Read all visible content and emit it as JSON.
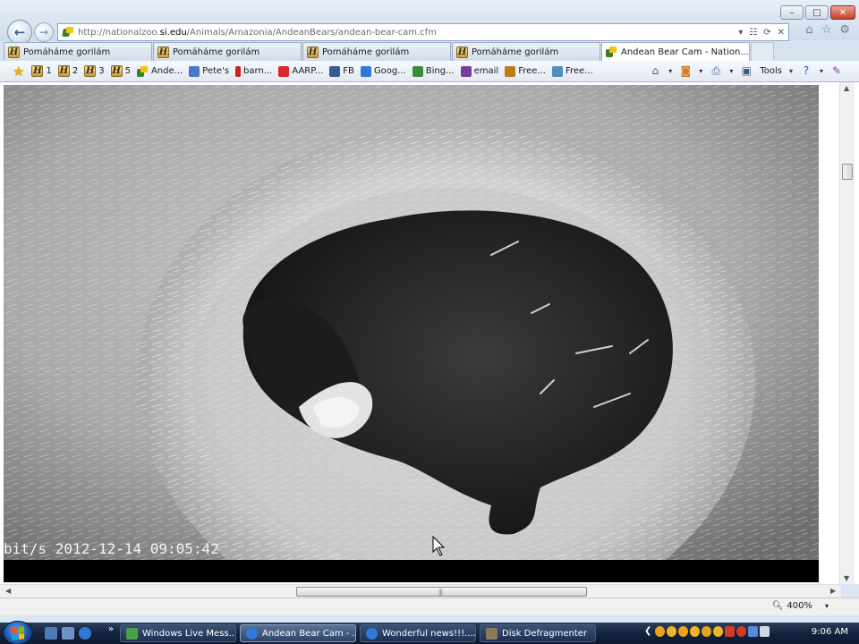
{
  "window": {
    "minimize_glyph": "–",
    "maximize_glyph": "□",
    "close_glyph": "✕"
  },
  "nav": {
    "back_glyph": "←",
    "forward_glyph": "→"
  },
  "address": {
    "url_prefix": "http://nationalzoo.",
    "url_domain": "si.edu",
    "url_path": "/Animals/Amazonia/AndeanBears/andean-bear-cam.cfm",
    "dropdown_glyph": "▾",
    "compat_glyph": "☷",
    "refresh_glyph": "⟳",
    "stop_glyph": "✕"
  },
  "chrome_right": {
    "home_glyph": "⌂",
    "favorites_glyph": "☆",
    "tools_glyph": "⚙"
  },
  "tabs": [
    {
      "label": "Pomáháme gorilám"
    },
    {
      "label": "Pomáháme gorilám"
    },
    {
      "label": "Pomáháme gorilám"
    },
    {
      "label": "Pomáháme gorilám"
    },
    {
      "label": "Andean Bear Cam - Nation...",
      "close": "✕"
    }
  ],
  "favorites_bar": {
    "items": [
      {
        "label": "1",
        "icon": "h-icon"
      },
      {
        "label": "2",
        "icon": "h-icon"
      },
      {
        "label": "3",
        "icon": "h-icon"
      },
      {
        "label": "5",
        "icon": "h-icon"
      },
      {
        "label": "Ande...",
        "icon": "zoo-icon"
      },
      {
        "label": "Pete's",
        "icon": "bookmark-icon",
        "color": "#4a78c8"
      },
      {
        "label": "barn...",
        "icon": "barnes-icon",
        "color": "#c9231b"
      },
      {
        "label": "AARP...",
        "icon": "aarp-icon",
        "color": "#d8282b"
      },
      {
        "label": "FB",
        "icon": "facebook-icon",
        "color": "#3b5998"
      },
      {
        "label": "Goog...",
        "icon": "google-icon",
        "color": "#2f7ad6"
      },
      {
        "label": "Bing...",
        "icon": "bing-icon",
        "color": "#3c8a3c"
      },
      {
        "label": "email",
        "icon": "email-icon",
        "color": "#7a3d9c"
      },
      {
        "label": "Free...",
        "icon": "free-icon",
        "color": "#c07a1c"
      },
      {
        "label": "Free...",
        "icon": "free-icon-2",
        "color": "#4f8fbe"
      }
    ]
  },
  "command_bar": {
    "tools_label": "Tools"
  },
  "video": {
    "timestamp": "bit/s 2012-12-14 09:05:42"
  },
  "status": {
    "zoom": "400%"
  },
  "taskbar": {
    "tasks": [
      {
        "label": "Windows Live Mess...",
        "color": "#4aa04a"
      },
      {
        "label": "Andean Bear Cam - ...",
        "color": "#2f7ad6"
      },
      {
        "label": "Wonderful news!!!.... ...",
        "color": "#2f7ad6"
      },
      {
        "label": "Disk Defragmenter",
        "color": "#8a7a5a"
      }
    ],
    "clock": "9:06 AM",
    "overflow_glyph": "»",
    "tray_chevron": "❮"
  }
}
